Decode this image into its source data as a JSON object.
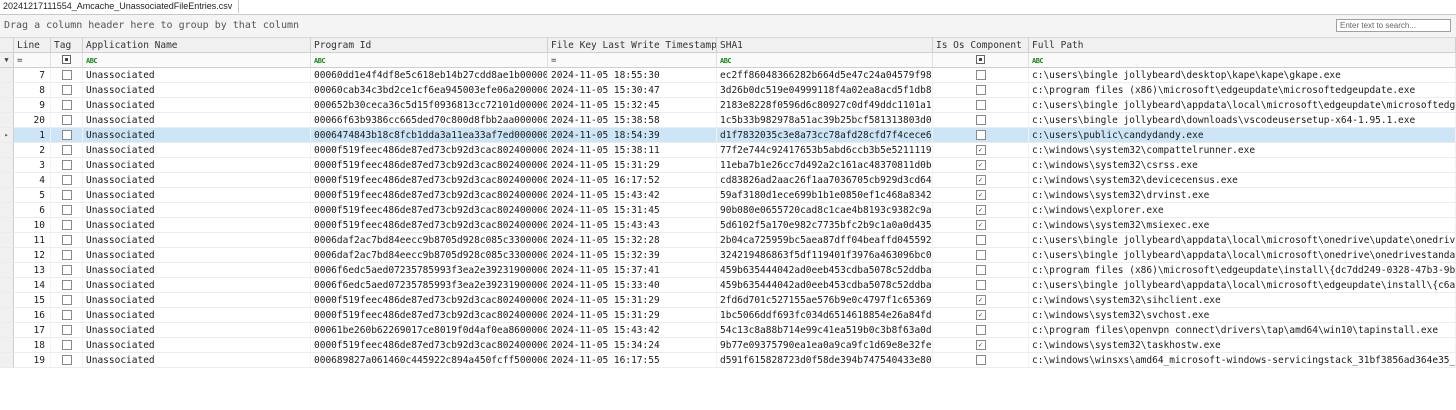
{
  "tab": {
    "label": "20241217111554_Amcache_UnassociatedFileEntries.csv"
  },
  "groupbar": {
    "hint": "Drag a column header here to group by that column"
  },
  "search": {
    "placeholder": "Enter text to search..."
  },
  "columns": {
    "line": "Line",
    "tag": "Tag",
    "app": "Application Name",
    "pid": "Program Id",
    "ts": "File Key Last Write Timestamp",
    "sha": "SHA1",
    "os": "Is Os Component",
    "path": "Full Path"
  },
  "filter": {
    "funnel_icon": "filter-funnel-icon",
    "equals": "=",
    "contains": "ABC"
  },
  "row_indicator": "▸",
  "rows": [
    {
      "line": "7",
      "app": "Unassociated",
      "pid": "00060dd1e4f4df8e5c618eb14b27cdd8ae1b00000000",
      "ts": "2024-11-05 18:55:30",
      "sha": "ec2ff86048366282b664d5e47c24a04579f98aba",
      "os": "",
      "path": "c:\\users\\bingle jollybeard\\desktop\\kape\\kape\\gkape.exe",
      "selected": false
    },
    {
      "line": "8",
      "app": "Unassociated",
      "pid": "00060cab34c3bd2ce1cf6ea945003efe06a200000904",
      "ts": "2024-11-05 15:30:47",
      "sha": "3d26b0dc519e04999118f4a02ea8acd5f1db8feb",
      "os": "",
      "path": "c:\\program files (x86)\\microsoft\\edgeupdate\\microsoftedgeupdate.exe",
      "selected": false
    },
    {
      "line": "9",
      "app": "Unassociated",
      "pid": "000652b30ceca36c5d15f0936813cc72101d00000904",
      "ts": "2024-11-05 15:32:45",
      "sha": "2183e8228f0596d6c80927c0df49ddc1101a1219",
      "os": "",
      "path": "c:\\users\\bingle jollybeard\\appdata\\local\\microsoft\\edgeupdate\\microsoftedgeupdate",
      "selected": false
    },
    {
      "line": "20",
      "app": "Unassociated",
      "pid": "00066f63b9386cc665ded70c800d8fbb2aa000000904",
      "ts": "2024-11-05 15:38:58",
      "sha": "1c5b33b982978a51ac39b25bcf581313803d00df",
      "os": "",
      "path": "c:\\users\\bingle jollybeard\\downloads\\vscodeusersetup-x64-1.95.1.exe",
      "selected": false
    },
    {
      "line": "1",
      "app": "Unassociated",
      "pid": "0006474843b18c8fcb1dda3a11ea33af7ed000000904",
      "ts": "2024-11-05 18:54:39",
      "sha": "d1f7832035c3e8a73cc78afd28cfd7f4cece6d20",
      "os": "",
      "path": "c:\\users\\public\\candydandy.exe",
      "selected": true
    },
    {
      "line": "2",
      "app": "Unassociated",
      "pid": "0000f519feec486de87ed73cb92d3cac802400000904",
      "ts": "2024-11-05 15:38:11",
      "sha": "77f2e744c92417653b5abd6ccb3b5e521111979a",
      "os": "✓",
      "path": "c:\\windows\\system32\\compattelrunner.exe",
      "selected": false
    },
    {
      "line": "3",
      "app": "Unassociated",
      "pid": "0000f519feec486de87ed73cb92d3cac802400000904",
      "ts": "2024-11-05 15:31:29",
      "sha": "11eba7b1e26cc7d492a2c161ac48370811d0b01e",
      "os": "✓",
      "path": "c:\\windows\\system32\\csrss.exe",
      "selected": false
    },
    {
      "line": "4",
      "app": "Unassociated",
      "pid": "0000f519feec486de87ed73cb92d3cac802400000904",
      "ts": "2024-11-05 16:17:52",
      "sha": "cd83826ad2aac26f1aa7036705cb929d3cd6469",
      "os": "✓",
      "path": "c:\\windows\\system32\\devicecensus.exe",
      "selected": false
    },
    {
      "line": "5",
      "app": "Unassociated",
      "pid": "0000f519feec486de87ed73cb92d3cac802400000904",
      "ts": "2024-11-05 15:43:42",
      "sha": "59af3180d1ece699b1b1e0850ef1c468a8342cfb",
      "os": "✓",
      "path": "c:\\windows\\system32\\drvinst.exe",
      "selected": false
    },
    {
      "line": "6",
      "app": "Unassociated",
      "pid": "0000f519feec486de87ed73cb92d3cac802400000904",
      "ts": "2024-11-05 15:31:45",
      "sha": "90b080e0655720cad8c1cae4b8193c9382c9ac92",
      "os": "✓",
      "path": "c:\\windows\\explorer.exe",
      "selected": false
    },
    {
      "line": "10",
      "app": "Unassociated",
      "pid": "0000f519feec486de87ed73cb92d3cac802400000904",
      "ts": "2024-11-05 15:43:43",
      "sha": "5d6102f5a170e982c7735bfc2b9c1a0a0d435fd1",
      "os": "✓",
      "path": "c:\\windows\\system32\\msiexec.exe",
      "selected": false
    },
    {
      "line": "11",
      "app": "Unassociated",
      "pid": "0006daf2ac7bd84eecc9b8705d928c085c3300000904",
      "ts": "2024-11-05 15:32:28",
      "sha": "2b04ca725959bc5aea87dff04beaffd045592c5e",
      "os": "",
      "path": "c:\\users\\bingle jollybeard\\appdata\\local\\microsoft\\onedrive\\update\\onedrivesetup.",
      "selected": false
    },
    {
      "line": "12",
      "app": "Unassociated",
      "pid": "0006daf2ac7bd84eecc9b8705d928c085c3300000904",
      "ts": "2024-11-05 15:32:39",
      "sha": "324219486863f5df119401f3976a463096bc026a",
      "os": "",
      "path": "c:\\users\\bingle jollybeard\\appdata\\local\\microsoft\\onedrive\\onedrivestandaloneupd",
      "selected": false
    },
    {
      "line": "13",
      "app": "Unassociated",
      "pid": "0006f6edc5aed07235785993f3ea2e39231900000904",
      "ts": "2024-11-05 15:37:41",
      "sha": "459b635444042ad0eeb453cdba5078c52ddba161",
      "os": "",
      "path": "c:\\program files (x86)\\microsoft\\edgeupdate\\install\\{dc7dd249-0328-47b3-9b24-8da",
      "selected": false
    },
    {
      "line": "14",
      "app": "Unassociated",
      "pid": "0006f6edc5aed07235785993f3ea2e39231900000904",
      "ts": "2024-11-05 15:33:40",
      "sha": "459b635444042ad0eeb453cdba5078c52ddba161",
      "os": "",
      "path": "c:\\users\\bingle jollybeard\\appdata\\local\\microsoft\\edgeupdate\\install\\{c6ae24d4-",
      "selected": false
    },
    {
      "line": "15",
      "app": "Unassociated",
      "pid": "0000f519feec486de87ed73cb92d3cac802400000904",
      "ts": "2024-11-05 15:31:29",
      "sha": "2fd6d701c527155ae576b9e0c4797f1c6536982b",
      "os": "✓",
      "path": "c:\\windows\\system32\\sihclient.exe",
      "selected": false
    },
    {
      "line": "16",
      "app": "Unassociated",
      "pid": "0000f519feec486de87ed73cb92d3cac802400000904",
      "ts": "2024-11-05 15:31:29",
      "sha": "1bc5066ddf693fc034d6514618854e26a84fd0d1",
      "os": "✓",
      "path": "c:\\windows\\system32\\svchost.exe",
      "selected": false
    },
    {
      "line": "17",
      "app": "Unassociated",
      "pid": "00061be260b62269017ce8019f0d4af0ea8600000904",
      "ts": "2024-11-05 15:43:42",
      "sha": "54c13c8a88b714e99c41ea519b0c3b8f63a0d6eb",
      "os": "",
      "path": "c:\\program files\\openvpn connect\\drivers\\tap\\amd64\\win10\\tapinstall.exe",
      "selected": false
    },
    {
      "line": "18",
      "app": "Unassociated",
      "pid": "0000f519feec486de87ed73cb92d3cac802400000904",
      "ts": "2024-11-05 15:34:24",
      "sha": "9b77e09375790ea1ea0a9ca9fc1d69e8e32fe597",
      "os": "✓",
      "path": "c:\\windows\\system32\\taskhostw.exe",
      "selected": false
    },
    {
      "line": "19",
      "app": "Unassociated",
      "pid": "000689827a061460c445922c894a450fcff500000904",
      "ts": "2024-11-05 16:17:55",
      "sha": "d591f615828723d0f58de394b747540433e80657",
      "os": "",
      "path": "c:\\windows\\winsxs\\amd64_microsoft-windows-servicingstack_31bf3856ad364e35_10.0.19",
      "selected": false
    }
  ]
}
